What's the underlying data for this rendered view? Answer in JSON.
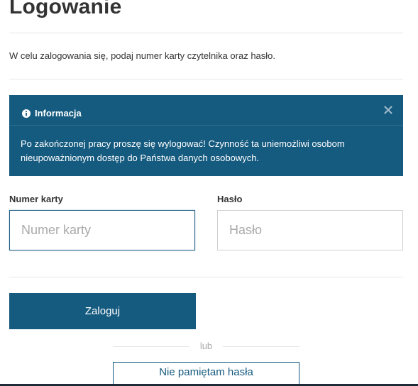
{
  "page": {
    "title": "Logowanie",
    "intro": "W celu zalogowania się, podaj numer karty czytelnika oraz hasło."
  },
  "info": {
    "heading": "Informacja",
    "text": "Po zakończonej pracy proszę się wylogować! Czynność ta uniemożliwi osobom nieupoważnionym dostęp do Państwa danych osobowych.",
    "icon": "info-circle-icon",
    "close_icon": "close-icon"
  },
  "form": {
    "card_label": "Numer karty",
    "card_placeholder": "Numer karty",
    "card_value": "",
    "password_label": "Hasło",
    "password_placeholder": "Hasło",
    "password_value": ""
  },
  "actions": {
    "login_label": "Zaloguj",
    "or_label": "lub",
    "forgot_label": "Nie pamiętam hasła"
  },
  "colors": {
    "accent": "#155a7f",
    "text": "#333333",
    "muted": "#a9a9a9",
    "divider": "#e6e6e6"
  }
}
